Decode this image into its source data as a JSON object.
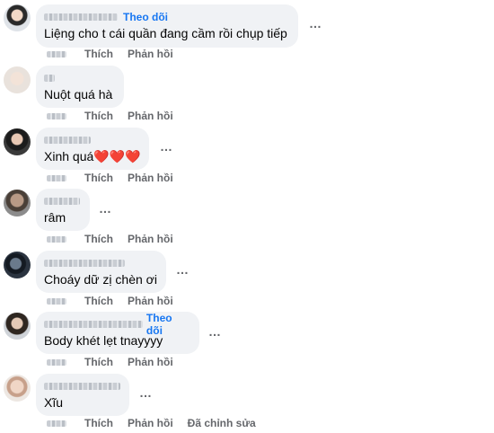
{
  "actions": {
    "like": "Thích",
    "reply": "Phản hồi",
    "edited": "Đã chỉnh sửa"
  },
  "comments": [
    {
      "follow": "Theo dõi",
      "text": "Liệng cho t cái quần đang cầm rồi chụp tiếp"
    },
    {
      "text": "Nuột quá hà"
    },
    {
      "text": "Xinh quá❤️❤️❤️"
    },
    {
      "text": "râm"
    },
    {
      "text": "Choáy dữ zị chèn ơi"
    },
    {
      "follow": "Theo dõi",
      "text": "Body khét lẹt tnayyyy"
    },
    {
      "text": "Xĩu"
    }
  ],
  "more_icon": "…"
}
